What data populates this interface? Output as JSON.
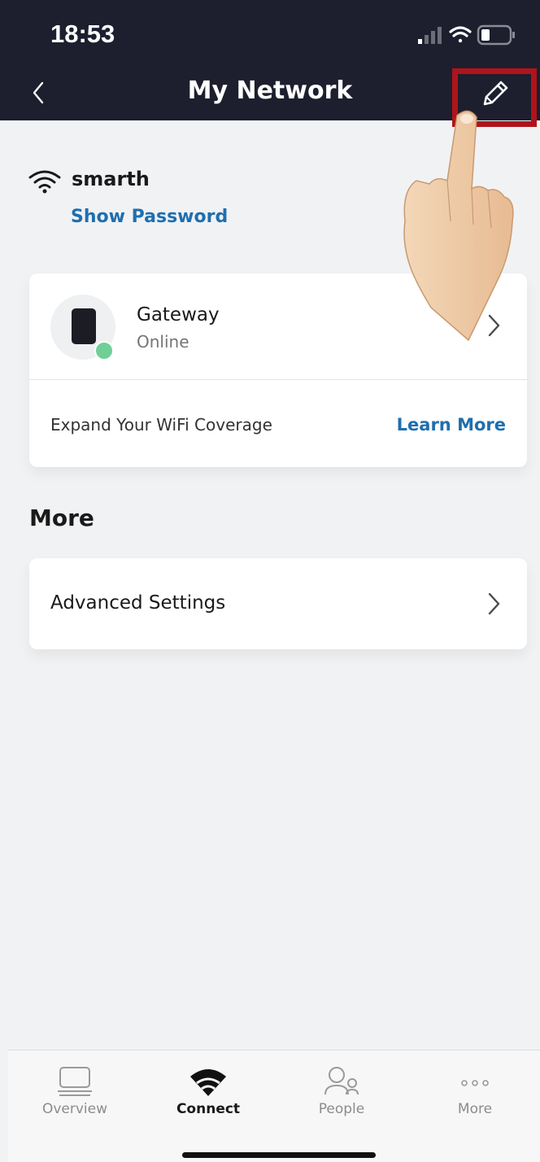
{
  "status_bar": {
    "time": "18:53"
  },
  "nav": {
    "title": "My Network"
  },
  "network": {
    "name": "smarth",
    "show_password": "Show Password"
  },
  "gateway": {
    "name": "Gateway",
    "status": "Online",
    "status_color": "#6fcf97"
  },
  "coverage": {
    "text": "Expand Your WiFi Coverage",
    "link": "Learn More"
  },
  "more_section": {
    "title": "More",
    "advanced_settings": "Advanced Settings"
  },
  "tabs": [
    {
      "label": "Overview",
      "icon": "laptop-icon",
      "active": false
    },
    {
      "label": "Connect",
      "icon": "wifi-icon",
      "active": true
    },
    {
      "label": "People",
      "icon": "people-icon",
      "active": false
    },
    {
      "label": "More",
      "icon": "more-dots-icon",
      "active": false
    }
  ],
  "colors": {
    "header_bg": "#1d1f2e",
    "accent": "#1f6fae",
    "highlight": "#b0141b",
    "background": "#f1f2f4"
  }
}
